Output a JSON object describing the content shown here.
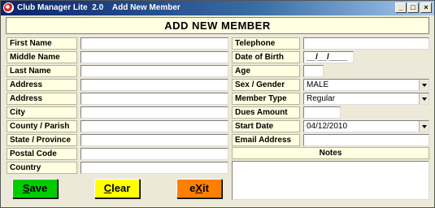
{
  "window": {
    "title": "Club Manager Lite  2.0    Add New Member",
    "controls": {
      "minimize": "_",
      "maximize": "□",
      "close": "×"
    }
  },
  "header": {
    "title": "ADD  NEW  MEMBER"
  },
  "form_left": [
    {
      "label": "First Name",
      "value": ""
    },
    {
      "label": "Middle Name",
      "value": ""
    },
    {
      "label": "Last Name",
      "value": ""
    },
    {
      "label": "Address",
      "value": ""
    },
    {
      "label": "Address",
      "value": ""
    },
    {
      "label": "City",
      "value": ""
    },
    {
      "label": "County / Parish",
      "value": ""
    },
    {
      "label": "State / Province",
      "value": ""
    },
    {
      "label": "Postal Code",
      "value": ""
    },
    {
      "label": "Country",
      "value": ""
    }
  ],
  "form_right": {
    "telephone": {
      "label": "Telephone",
      "value": ""
    },
    "date_of_birth": {
      "label": "Date of Birth",
      "value": "__/__/____"
    },
    "age": {
      "label": "Age",
      "value": ""
    },
    "sex_gender": {
      "label": "Sex / Gender",
      "value": "MALE"
    },
    "member_type": {
      "label": "Member Type",
      "value": "Regular"
    },
    "dues_amount": {
      "label": "Dues Amount",
      "value": ""
    },
    "start_date": {
      "label": "Start Date",
      "value": "04/12/2010"
    },
    "email": {
      "label": "Email Address",
      "value": ""
    },
    "notes": {
      "label": "Notes",
      "value": ""
    }
  },
  "buttons": {
    "save": {
      "pre": "",
      "hot": "S",
      "post": "ave",
      "color": "#00cc00"
    },
    "clear": {
      "pre": "",
      "hot": "C",
      "post": "lear",
      "color": "#ffff00"
    },
    "exit": {
      "pre": "e",
      "hot": "X",
      "post": "it",
      "color": "#ff7f00"
    }
  }
}
